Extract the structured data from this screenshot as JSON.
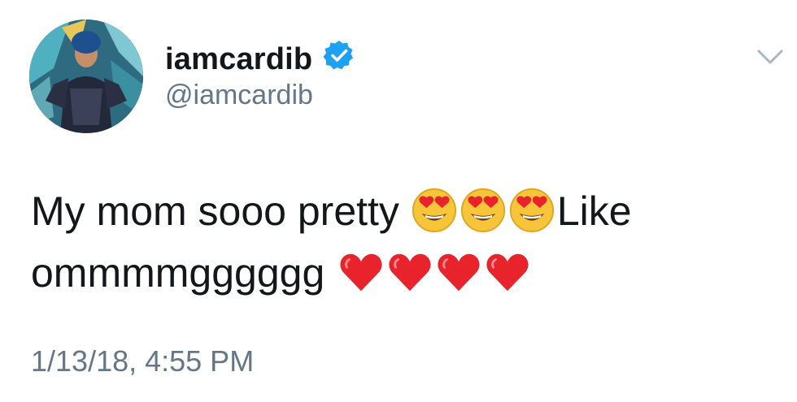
{
  "tweet": {
    "display_name": "iamcardib",
    "handle": "@iamcardib",
    "verified": true,
    "text_line1": "My mom sooo pretty",
    "text_line1_suffix": "Like",
    "text_line2": "ommmmgggggg",
    "emoji_faces": [
      "smiling-face-with-heart-eyes",
      "smiling-face-with-heart-eyes",
      "smiling-face-with-heart-eyes"
    ],
    "emoji_hearts": [
      "red-heart",
      "red-heart",
      "red-heart",
      "red-heart"
    ],
    "timestamp": "1/13/18, 4:55 PM"
  },
  "icons": {
    "verified": "verified-badge-icon",
    "menu": "chevron-down-icon"
  },
  "colors": {
    "name": "#14171a",
    "secondary": "#657786",
    "verified": "#1da1f2",
    "heart": "#e8232b",
    "emoji_face": "#f7c53a"
  }
}
